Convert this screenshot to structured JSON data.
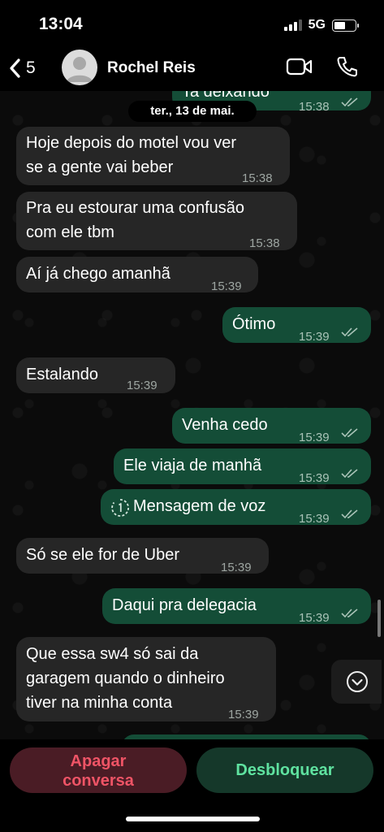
{
  "status_bar": {
    "time": "13:04",
    "network": "5G"
  },
  "header": {
    "back_count": "5",
    "contact_name": "Rochel Reis"
  },
  "date_chip": "ter., 13 de mai.",
  "messages": [
    {
      "dir": "out",
      "text": "Ta deixando",
      "time": "15:38",
      "ticks": true
    },
    {
      "dir": "in",
      "text_lines": [
        "Hoje depois do motel vou ver",
        "se a gente vai beber"
      ],
      "time": "15:38"
    },
    {
      "dir": "in",
      "text_lines": [
        "Pra eu estourar uma confusão",
        "com ele tbm"
      ],
      "time": "15:38"
    },
    {
      "dir": "in",
      "text": "Aí já chego amanhã",
      "time": "15:39"
    },
    {
      "dir": "out",
      "text": "Ótimo",
      "time": "15:39",
      "ticks": true
    },
    {
      "dir": "in",
      "text": "Estalando",
      "time": "15:39"
    },
    {
      "dir": "out",
      "text": "Venha cedo",
      "time": "15:39",
      "ticks": true
    },
    {
      "dir": "out",
      "text": "Ele viaja de manhã",
      "time": "15:39",
      "ticks": true
    },
    {
      "dir": "out",
      "text": "Mensagem de voz",
      "time": "15:39",
      "ticks": true,
      "icon": "view-once-icon"
    },
    {
      "dir": "in",
      "text": "Só se ele for de Uber",
      "time": "15:39"
    },
    {
      "dir": "out",
      "text": "Daqui pra delegacia",
      "time": "15:39",
      "ticks": true
    },
    {
      "dir": "in",
      "text_lines": [
        "Que essa sw4 só sai da",
        "garagem quando o dinheiro",
        "tiver na minha conta"
      ],
      "time": "15:39"
    }
  ],
  "actions": {
    "delete_lines": [
      "Apagar",
      "conversa"
    ],
    "unblock": "Desbloquear"
  },
  "colors": {
    "incoming": "#262626",
    "outgoing": "#144d37",
    "delete": "#ef5466",
    "unblock": "#5fe2a0"
  },
  "icons": [
    "back-chevron-icon",
    "avatar-placeholder-icon",
    "video-call-icon",
    "phone-icon",
    "double-check-icon",
    "view-once-icon",
    "scroll-down-icon"
  ]
}
